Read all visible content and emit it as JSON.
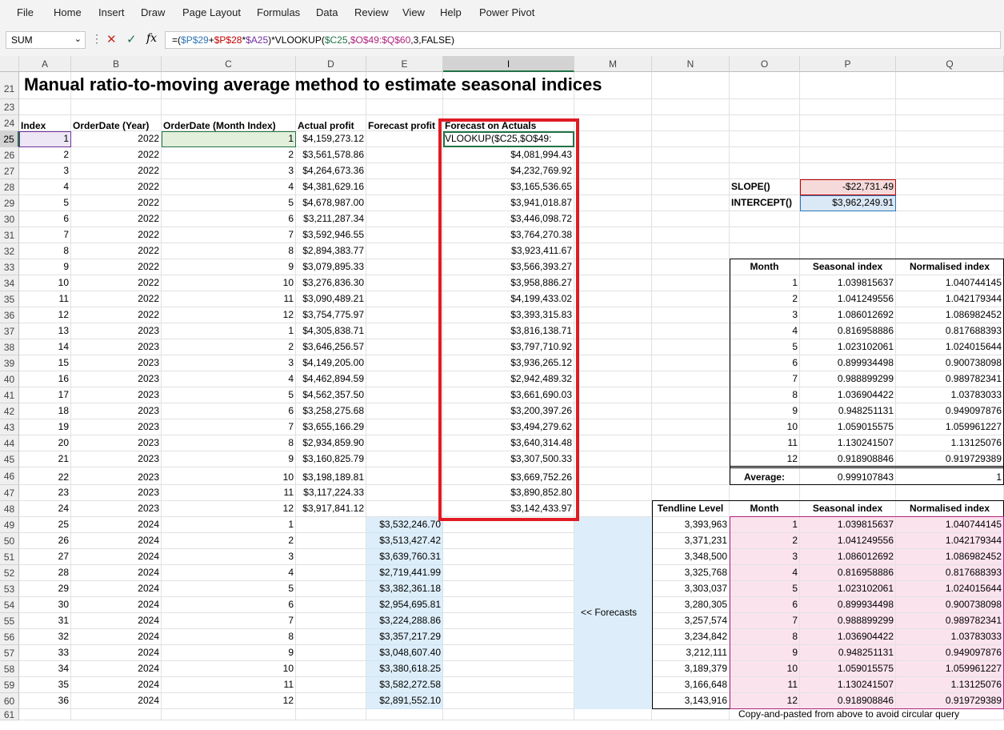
{
  "menu": [
    "File",
    "Home",
    "Insert",
    "Draw",
    "Page Layout",
    "Formulas",
    "Data",
    "Review",
    "View",
    "Help",
    "Power Pivot"
  ],
  "name_box": "SUM",
  "formula_bar": {
    "fx": "fx",
    "parts": [
      {
        "t": "=(",
        "c": "#000000"
      },
      {
        "t": "$P$29",
        "c": "#2e75b6"
      },
      {
        "t": "+",
        "c": "#000000"
      },
      {
        "t": "$P$28",
        "c": "#c00000"
      },
      {
        "t": "*",
        "c": "#000000"
      },
      {
        "t": "$A25",
        "c": "#7030a0"
      },
      {
        "t": ")*VLOOKUP(",
        "c": "#000000"
      },
      {
        "t": "$C25",
        "c": "#217346"
      },
      {
        "t": ",",
        "c": "#000000"
      },
      {
        "t": "$O$49:$Q$60",
        "c": "#b0237c"
      },
      {
        "t": ",3,FALSE)",
        "c": "#000000"
      }
    ]
  },
  "column_headers": [
    "A",
    "B",
    "C",
    "D",
    "E",
    "I",
    "M",
    "N",
    "O",
    "P",
    "Q"
  ],
  "title": "Manual ratio-to-moving average method to estimate seasonal indices",
  "table_headers": [
    "Index",
    "OrderDate (Year)",
    "OrderDate (Month Index)",
    "Actual profit",
    "Forecast profit",
    "Forecast on Actuals"
  ],
  "rows": [
    {
      "idx": "1",
      "year": "2022",
      "month": "1",
      "actual": "$4,159,273.12",
      "forecast": "",
      "foa": "VLOOKUP($C25,$O$49:"
    },
    {
      "idx": "2",
      "year": "2022",
      "month": "2",
      "actual": "$3,561,578.86",
      "forecast": "",
      "foa": "$4,081,994.43"
    },
    {
      "idx": "3",
      "year": "2022",
      "month": "3",
      "actual": "$4,264,673.36",
      "forecast": "",
      "foa": "$4,232,769.92"
    },
    {
      "idx": "4",
      "year": "2022",
      "month": "4",
      "actual": "$4,381,629.16",
      "forecast": "",
      "foa": "$3,165,536.65"
    },
    {
      "idx": "5",
      "year": "2022",
      "month": "5",
      "actual": "$4,678,987.00",
      "forecast": "",
      "foa": "$3,941,018.87"
    },
    {
      "idx": "6",
      "year": "2022",
      "month": "6",
      "actual": "$3,211,287.34",
      "forecast": "",
      "foa": "$3,446,098.72"
    },
    {
      "idx": "7",
      "year": "2022",
      "month": "7",
      "actual": "$3,592,946.55",
      "forecast": "",
      "foa": "$3,764,270.38"
    },
    {
      "idx": "8",
      "year": "2022",
      "month": "8",
      "actual": "$2,894,383.77",
      "forecast": "",
      "foa": "$3,923,411.67"
    },
    {
      "idx": "9",
      "year": "2022",
      "month": "9",
      "actual": "$3,079,895.33",
      "forecast": "",
      "foa": "$3,566,393.27"
    },
    {
      "idx": "10",
      "year": "2022",
      "month": "10",
      "actual": "$3,276,836.30",
      "forecast": "",
      "foa": "$3,958,886.27"
    },
    {
      "idx": "11",
      "year": "2022",
      "month": "11",
      "actual": "$3,090,489.21",
      "forecast": "",
      "foa": "$4,199,433.02"
    },
    {
      "idx": "12",
      "year": "2022",
      "month": "12",
      "actual": "$3,754,775.97",
      "forecast": "",
      "foa": "$3,393,315.83"
    },
    {
      "idx": "13",
      "year": "2023",
      "month": "1",
      "actual": "$4,305,838.71",
      "forecast": "",
      "foa": "$3,816,138.71"
    },
    {
      "idx": "14",
      "year": "2023",
      "month": "2",
      "actual": "$3,646,256.57",
      "forecast": "",
      "foa": "$3,797,710.92"
    },
    {
      "idx": "15",
      "year": "2023",
      "month": "3",
      "actual": "$4,149,205.00",
      "forecast": "",
      "foa": "$3,936,265.12"
    },
    {
      "idx": "16",
      "year": "2023",
      "month": "4",
      "actual": "$4,462,894.59",
      "forecast": "",
      "foa": "$2,942,489.32"
    },
    {
      "idx": "17",
      "year": "2023",
      "month": "5",
      "actual": "$4,562,357.50",
      "forecast": "",
      "foa": "$3,661,690.03"
    },
    {
      "idx": "18",
      "year": "2023",
      "month": "6",
      "actual": "$3,258,275.68",
      "forecast": "",
      "foa": "$3,200,397.26"
    },
    {
      "idx": "19",
      "year": "2023",
      "month": "7",
      "actual": "$3,655,166.29",
      "forecast": "",
      "foa": "$3,494,279.62"
    },
    {
      "idx": "20",
      "year": "2023",
      "month": "8",
      "actual": "$2,934,859.90",
      "forecast": "",
      "foa": "$3,640,314.48"
    },
    {
      "idx": "21",
      "year": "2023",
      "month": "9",
      "actual": "$3,160,825.79",
      "forecast": "",
      "foa": "$3,307,500.33"
    },
    {
      "idx": "22",
      "year": "2023",
      "month": "10",
      "actual": "$3,198,189.81",
      "forecast": "",
      "foa": "$3,669,752.26"
    },
    {
      "idx": "23",
      "year": "2023",
      "month": "11",
      "actual": "$3,117,224.33",
      "forecast": "",
      "foa": "$3,890,852.80"
    },
    {
      "idx": "24",
      "year": "2023",
      "month": "12",
      "actual": "$3,917,841.12",
      "forecast": "",
      "foa": "$3,142,433.97"
    },
    {
      "idx": "25",
      "year": "2024",
      "month": "1",
      "actual": "",
      "forecast": "$3,532,246.70",
      "foa": ""
    },
    {
      "idx": "26",
      "year": "2024",
      "month": "2",
      "actual": "",
      "forecast": "$3,513,427.42",
      "foa": ""
    },
    {
      "idx": "27",
      "year": "2024",
      "month": "3",
      "actual": "",
      "forecast": "$3,639,760.31",
      "foa": ""
    },
    {
      "idx": "28",
      "year": "2024",
      "month": "4",
      "actual": "",
      "forecast": "$2,719,441.99",
      "foa": ""
    },
    {
      "idx": "29",
      "year": "2024",
      "month": "5",
      "actual": "",
      "forecast": "$3,382,361.18",
      "foa": ""
    },
    {
      "idx": "30",
      "year": "2024",
      "month": "6",
      "actual": "",
      "forecast": "$2,954,695.81",
      "foa": ""
    },
    {
      "idx": "31",
      "year": "2024",
      "month": "7",
      "actual": "",
      "forecast": "$3,224,288.86",
      "foa": ""
    },
    {
      "idx": "32",
      "year": "2024",
      "month": "8",
      "actual": "",
      "forecast": "$3,357,217.29",
      "foa": ""
    },
    {
      "idx": "33",
      "year": "2024",
      "month": "9",
      "actual": "",
      "forecast": "$3,048,607.40",
      "foa": ""
    },
    {
      "idx": "34",
      "year": "2024",
      "month": "10",
      "actual": "",
      "forecast": "$3,380,618.25",
      "foa": ""
    },
    {
      "idx": "35",
      "year": "2024",
      "month": "11",
      "actual": "",
      "forecast": "$3,582,272.58",
      "foa": ""
    },
    {
      "idx": "36",
      "year": "2024",
      "month": "12",
      "actual": "",
      "forecast": "$2,891,552.10",
      "foa": ""
    }
  ],
  "slope": {
    "label": "SLOPE()",
    "value": "-$22,731.49"
  },
  "intercept": {
    "label": "INTERCEPT()",
    "value": "$3,962,249.91"
  },
  "seasonal_headers": [
    "Month",
    "Seasonal index",
    "Normalised index"
  ],
  "seasonal": [
    {
      "m": "1",
      "s": "1.039815637",
      "n": "1.040744145"
    },
    {
      "m": "2",
      "s": "1.041249556",
      "n": "1.042179344"
    },
    {
      "m": "3",
      "s": "1.086012692",
      "n": "1.086982452"
    },
    {
      "m": "4",
      "s": "0.816958886",
      "n": "0.817688393"
    },
    {
      "m": "5",
      "s": "1.023102061",
      "n": "1.024015644"
    },
    {
      "m": "6",
      "s": "0.899934498",
      "n": "0.900738098"
    },
    {
      "m": "7",
      "s": "0.988899299",
      "n": "0.989782341"
    },
    {
      "m": "8",
      "s": "1.036904422",
      "n": "1.03783033"
    },
    {
      "m": "9",
      "s": "0.948251131",
      "n": "0.949097876"
    },
    {
      "m": "10",
      "s": "1.059015575",
      "n": "1.059961227"
    },
    {
      "m": "11",
      "s": "1.130241507",
      "n": "1.13125076"
    },
    {
      "m": "12",
      "s": "0.918908846",
      "n": "0.919729389"
    }
  ],
  "average": {
    "label": "Average:",
    "s": "0.999107843",
    "n": "1"
  },
  "tendline_header": "Tendline Level",
  "tendline": [
    "3,393,963",
    "3,371,231",
    "3,348,500",
    "3,325,768",
    "3,303,037",
    "3,280,305",
    "3,257,574",
    "3,234,842",
    "3,212,111",
    "3,189,379",
    "3,166,648",
    "3,143,916"
  ],
  "forecasts_label": "<<  Forecasts",
  "copy_note": "Copy-and-pasted from above to avoid circular query",
  "colors": {
    "forecast_fill": "#ddeefa",
    "pink_fill": "#fbe3ee",
    "red_box": "#e01b24",
    "selected_fill": "#e2efda",
    "excel_green": "#217346"
  }
}
